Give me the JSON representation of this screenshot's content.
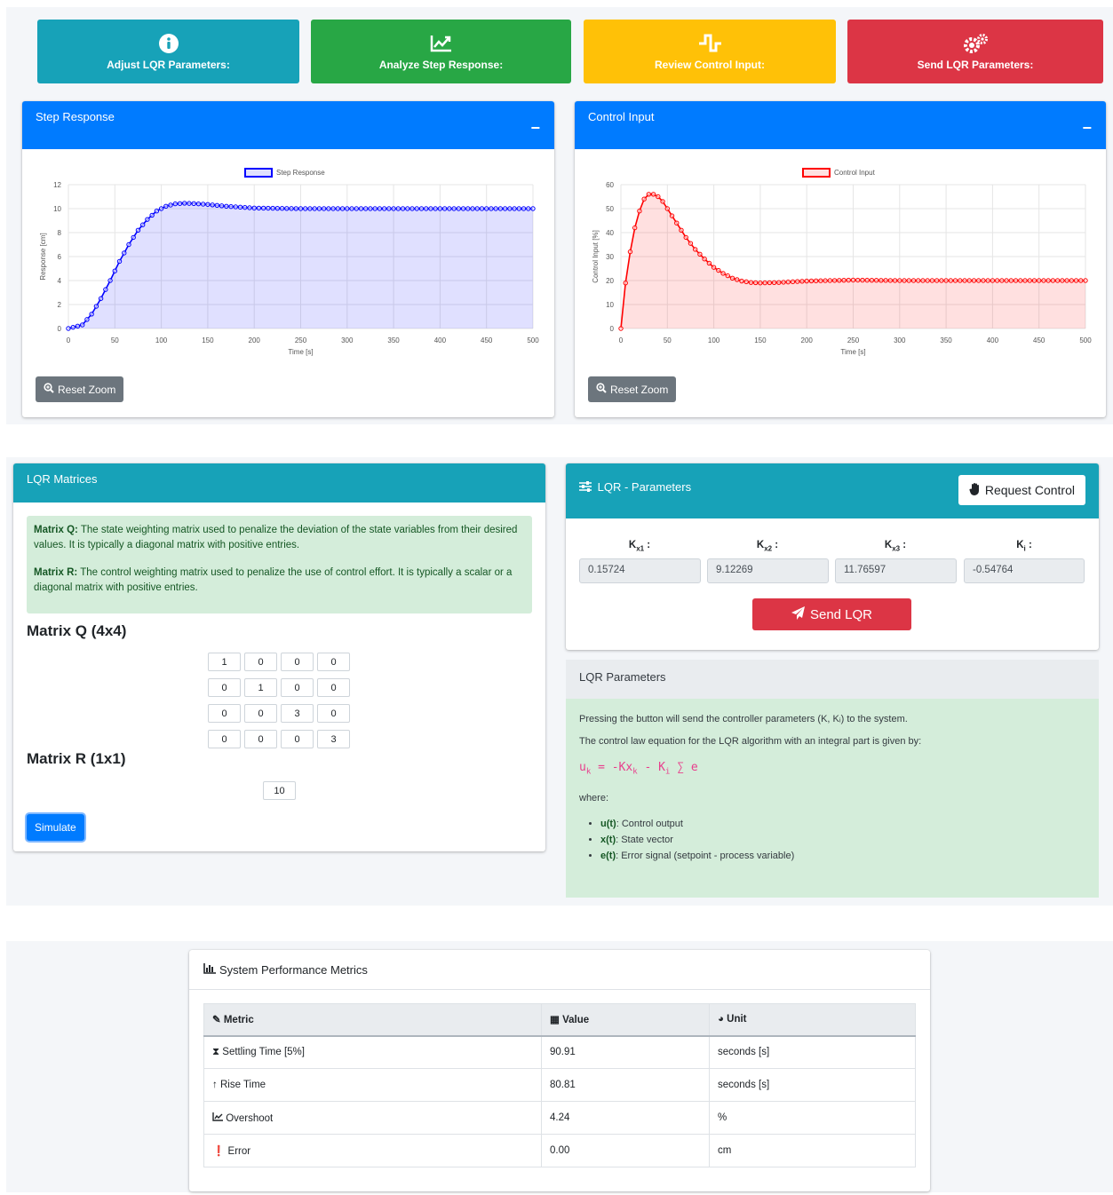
{
  "top_buttons": [
    {
      "label": "Adjust LQR Parameters:",
      "icon": "info-circle-icon"
    },
    {
      "label": "Analyze Step Response:",
      "icon": "chart-line-icon"
    },
    {
      "label": "Review Control Input:",
      "icon": "square-wave-icon"
    },
    {
      "label": "Send LQR Parameters:",
      "icon": "gears-icon"
    }
  ],
  "step_card": {
    "title": "Step Response",
    "collapse": "−",
    "reset_label": "Reset Zoom"
  },
  "control_card": {
    "title": "Control Input",
    "collapse": "−",
    "reset_label": "Reset Zoom"
  },
  "colors": {
    "info": "#17a2b8",
    "success": "#28a745",
    "warning": "#ffc107",
    "danger": "#dc3545",
    "primary": "#007bff"
  },
  "chart_data": [
    {
      "type": "area",
      "legend": "Step Response",
      "xlabel": "Time [s]",
      "ylabel": "Response [cm]",
      "xlim": [
        0,
        500
      ],
      "ylim": [
        0,
        12
      ],
      "xticks": [
        0,
        50,
        100,
        150,
        200,
        250,
        300,
        350,
        400,
        450,
        500
      ],
      "yticks": [
        0,
        2,
        4,
        6,
        8,
        10,
        12
      ],
      "grid": true,
      "legend_position": "top",
      "color": "#0000ff",
      "fill": "rgba(0,0,255,0.12)",
      "x": [
        0,
        15,
        25,
        35,
        45,
        55,
        65,
        75,
        85,
        95,
        105,
        115,
        125,
        135,
        150,
        170,
        200,
        250,
        300,
        350,
        400,
        450,
        500
      ],
      "y": [
        0,
        0.3,
        1.2,
        2.5,
        4.0,
        5.6,
        7.0,
        8.2,
        9.1,
        9.8,
        10.2,
        10.4,
        10.45,
        10.42,
        10.35,
        10.2,
        10.05,
        10.0,
        10.0,
        10.0,
        10.0,
        10.0,
        10.0
      ]
    },
    {
      "type": "area",
      "legend": "Control Input",
      "xlabel": "Time [s]",
      "ylabel": "Control Input [%]",
      "xlim": [
        0,
        500
      ],
      "ylim": [
        0,
        60
      ],
      "xticks": [
        0,
        50,
        100,
        150,
        200,
        250,
        300,
        350,
        400,
        450,
        500
      ],
      "yticks": [
        0,
        10,
        20,
        30,
        40,
        50,
        60
      ],
      "grid": true,
      "legend_position": "top",
      "color": "#ff0000",
      "fill": "rgba(255,0,0,0.12)",
      "x": [
        0,
        5,
        10,
        15,
        20,
        25,
        30,
        35,
        40,
        45,
        50,
        60,
        70,
        80,
        90,
        100,
        110,
        120,
        130,
        140,
        150,
        170,
        200,
        250,
        300,
        350,
        400,
        450,
        500
      ],
      "y": [
        0,
        19,
        32,
        42,
        49,
        54,
        56,
        56,
        55,
        53,
        50,
        44,
        38,
        33,
        29,
        25.5,
        23,
        21,
        19.8,
        19.2,
        19,
        19.2,
        19.8,
        20.2,
        20,
        20,
        20,
        20,
        20
      ]
    }
  ],
  "matrices": {
    "title": "LQR Matrices",
    "q_label": "Matrix Q:",
    "q_desc": " The state weighting matrix used to penalize the deviation of the state variables from their desired values. It is typically a diagonal matrix with positive entries.",
    "r_label": "Matrix R:",
    "r_desc": " The control weighting matrix used to penalize the use of control effort. It is typically a scalar or a diagonal matrix with positive entries.",
    "q_heading": "Matrix Q (4x4)",
    "q": [
      [
        "1",
        "0",
        "0",
        "0"
      ],
      [
        "0",
        "1",
        "0",
        "0"
      ],
      [
        "0",
        "0",
        "3",
        "0"
      ],
      [
        "0",
        "0",
        "0",
        "3"
      ]
    ],
    "r_heading": "Matrix R (1x1)",
    "r": "10",
    "simulate_label": "Simulate"
  },
  "lqr_params": {
    "title": "LQR - Parameters",
    "request_label": "Request Control",
    "gains": [
      {
        "label": "K",
        "sub": "x1",
        "suffix": " :",
        "value": "0.15724"
      },
      {
        "label": "K",
        "sub": "x2",
        "suffix": " :",
        "value": "9.12269"
      },
      {
        "label": "K",
        "sub": "x3",
        "suffix": " :",
        "value": "11.76597"
      },
      {
        "label": "K",
        "sub": "i",
        "suffix": " :",
        "value": "-0.54764"
      }
    ],
    "send_label": "Send LQR"
  },
  "lqr_info": {
    "title": "LQR Parameters",
    "text1": "Pressing the button will send the controller parameters (K, Kᵢ) to the system.",
    "text2": "The control law equation for the LQR algorithm with an integral part is given by:",
    "eq": {
      "u": "u",
      "u_sub": "k",
      "mid": " = -Kx",
      "x_sub": "k",
      "mid2": " - K",
      "ki_sub": "i",
      "end": " ∑ e"
    },
    "where": "where:",
    "items": [
      {
        "term": "u(t)",
        "desc": ": Control output"
      },
      {
        "term": "x(t)",
        "desc": ": State vector"
      },
      {
        "term": "e(t)",
        "desc": ": Error signal (setpoint - process variable)"
      }
    ]
  },
  "metrics": {
    "title": "System Performance Metrics",
    "headers": [
      "Metric",
      "Value",
      "Unit"
    ],
    "rows": [
      {
        "metric": "Settling Time [5%]",
        "value": "90.91",
        "unit": "seconds [s]",
        "icon": "hourglass-icon"
      },
      {
        "metric": "Rise Time",
        "value": "80.81",
        "unit": "seconds [s]",
        "icon": "arrow-up-icon"
      },
      {
        "metric": "Overshoot",
        "value": "4.24",
        "unit": "%",
        "icon": "chart-line-icon"
      },
      {
        "metric": "Error",
        "value": "0.00",
        "unit": "cm",
        "icon": "exclamation-circle-icon"
      }
    ]
  }
}
